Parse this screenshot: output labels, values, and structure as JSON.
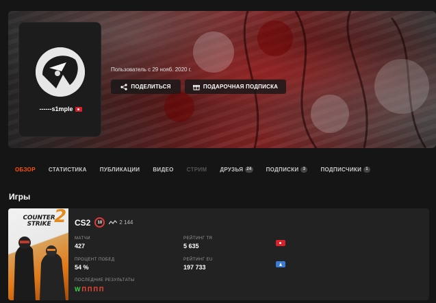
{
  "profile": {
    "nickname": "------s1mple",
    "member_since": "Пользователь с 29 нояб. 2020 г."
  },
  "actions": {
    "share_label": "ПОДЕЛИТЬСЯ",
    "gift_label": "ПОДАРОЧНАЯ ПОДПИСКА"
  },
  "tabs": [
    {
      "label": "ОБЗОР",
      "active": true
    },
    {
      "label": "СТАТИСТИКА"
    },
    {
      "label": "ПУБЛИКАЦИИ"
    },
    {
      "label": "ВИДЕО"
    },
    {
      "label": "СТРИМ",
      "disabled": true
    },
    {
      "label": "ДРУЗЬЯ",
      "count": "24"
    },
    {
      "label": "ПОДПИСКИ",
      "count": "3"
    },
    {
      "label": "ПОДПИСЧИКИ",
      "count": "1"
    }
  ],
  "section": {
    "title": "Игры"
  },
  "game": {
    "name": "CS2",
    "level": "10",
    "elo": "2 144",
    "cover_title_line1": "COUNTER",
    "cover_title_line2": "STRIKE",
    "cover_number": "2",
    "stats": {
      "matches_label": "МАТЧИ",
      "matches_value": "427",
      "rating_tr_label": "РЕЙТИНГ TR",
      "rating_tr_value": "5 635",
      "winrate_label": "ПРОЦЕНТ ПОБЕД",
      "winrate_value": "54 %",
      "rating_eu_label": "РЕЙТИНГ EU",
      "rating_eu_value": "197 733",
      "recent_label": "ПОСЛЕДНИЕ РЕЗУЛЬТАТЫ"
    },
    "recent_results": [
      "W",
      "П",
      "П",
      "П",
      "П"
    ]
  },
  "colors": {
    "accent": "#ff5500",
    "win": "#3bd14a",
    "loss": "#ff4a36",
    "level_ring": "#e43b3b"
  },
  "icons": {
    "share": "share-icon",
    "gift": "gift-icon",
    "elo": "elo-graph-icon"
  }
}
